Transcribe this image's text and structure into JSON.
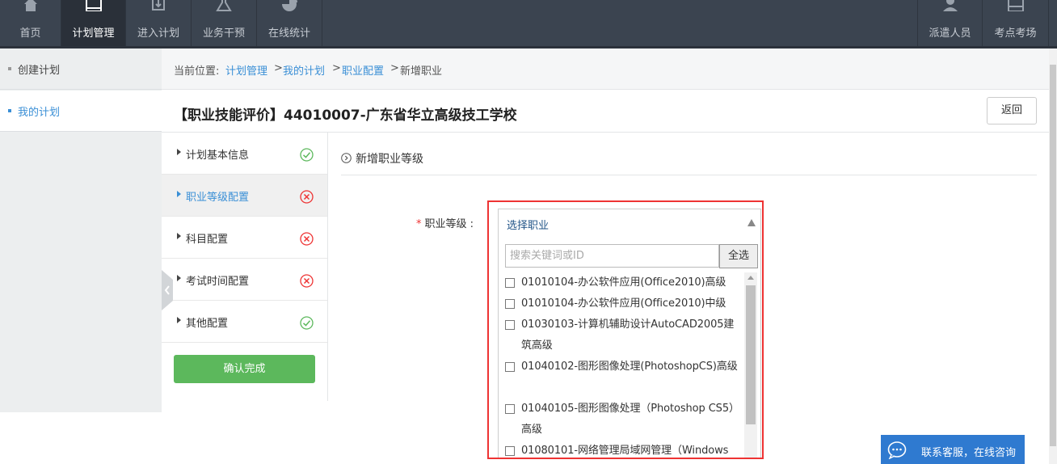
{
  "nav": {
    "items": [
      {
        "label": "首页",
        "icon": "home-icon"
      },
      {
        "label": "计划管理",
        "icon": "calendar-icon",
        "active": true
      },
      {
        "label": "进入计划",
        "icon": "enter-plan-icon"
      },
      {
        "label": "业务干预",
        "icon": "flask-icon"
      },
      {
        "label": "在线统计",
        "icon": "pie-chart-icon"
      }
    ],
    "right_items": [
      {
        "label": "派遣人员",
        "icon": "user-icon"
      },
      {
        "label": "考点考场",
        "icon": "exam-room-icon"
      }
    ]
  },
  "left_menu": {
    "items": [
      {
        "label": "创建计划"
      },
      {
        "label": "我的计划",
        "selected": true
      }
    ]
  },
  "breadcrumb": {
    "prefix": "当前位置:",
    "links": [
      "计划管理",
      "我的计划",
      "职业配置"
    ],
    "current": "新增职业",
    "separator": ">"
  },
  "page": {
    "title": "【职业技能评价】44010007-广东省华立高级技工学校",
    "back_label": "返回"
  },
  "steps": [
    {
      "label": "计划基本信息",
      "status": "done"
    },
    {
      "label": "职业等级配置",
      "status": "error",
      "current": true
    },
    {
      "label": "科目配置",
      "status": "error"
    },
    {
      "label": "考试时间配置",
      "status": "error"
    },
    {
      "label": "其他配置",
      "status": "done"
    }
  ],
  "confirm_label": "确认完成",
  "section": {
    "title": "新增职业等级",
    "field_label": "职业等级",
    "field_suffix": ":",
    "select": {
      "value": "选择职业",
      "search_placeholder": "搜索关键词或ID",
      "search_value": "",
      "select_all_label": "全选",
      "options": [
        {
          "label": "01010104-办公软件应用(Office2010)高级",
          "checked": false
        },
        {
          "label": "01010104-办公软件应用(Office2010)中级",
          "checked": false
        },
        {
          "label": "01030103-计算机辅助设计AutoCAD2005建筑高级",
          "checked": false
        },
        {
          "label": "01040102-图形图像处理(PhotoshopCS)高级",
          "checked": false
        },
        {
          "label": "01040105-图形图像处理（Photoshop CS5）高级",
          "checked": false
        },
        {
          "label": "01080101-网络管理局域网管理（Windows",
          "checked": false
        }
      ]
    }
  },
  "chat": {
    "label": "联系客服，在线咨询"
  },
  "colors": {
    "nav_bg": "#3b4450",
    "link": "#3a8fd6",
    "success": "#5cb85c",
    "error": "#e33333",
    "chat": "#2f7ad0"
  }
}
